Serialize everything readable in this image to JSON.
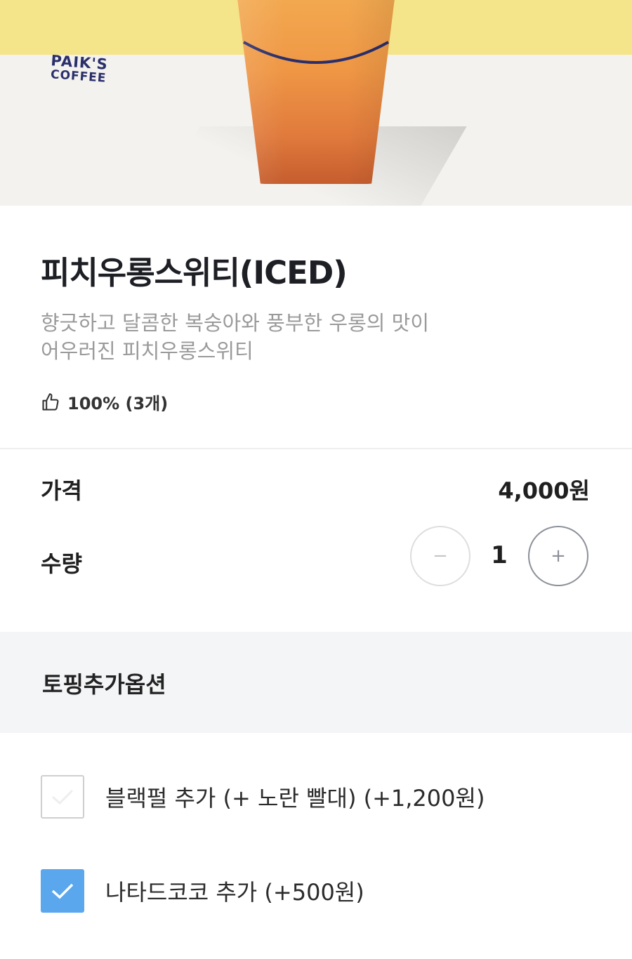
{
  "hero": {
    "brand_line1": "PAIK'S",
    "brand_line2": "COFFEE",
    "colors": {
      "top_band": "#f5e58a",
      "background": "#f3f2ee",
      "drink": "#ef9745"
    }
  },
  "product": {
    "title": "피치우롱스위티(ICED)",
    "description_line1": "향긋하고 달콤한 복숭아와 풍부한 우롱의 맛이",
    "description_line2": "어우러진 피치우롱스위티",
    "rating_icon": "thumbs-up-icon",
    "rating_text": "100% (3개)"
  },
  "price": {
    "label": "가격",
    "value": "4,000원"
  },
  "quantity": {
    "label": "수량",
    "minus": "−",
    "plus": "+",
    "value": "1"
  },
  "toppings": {
    "section_title": "토핑추가옵션",
    "options": [
      {
        "label": "블랙펄 추가 (+ 노란 빨대) (+1,200원)",
        "checked": false
      },
      {
        "label": "나타드코코 추가 (+500원)",
        "checked": true
      }
    ],
    "checked_color": "#5aa7ee"
  }
}
